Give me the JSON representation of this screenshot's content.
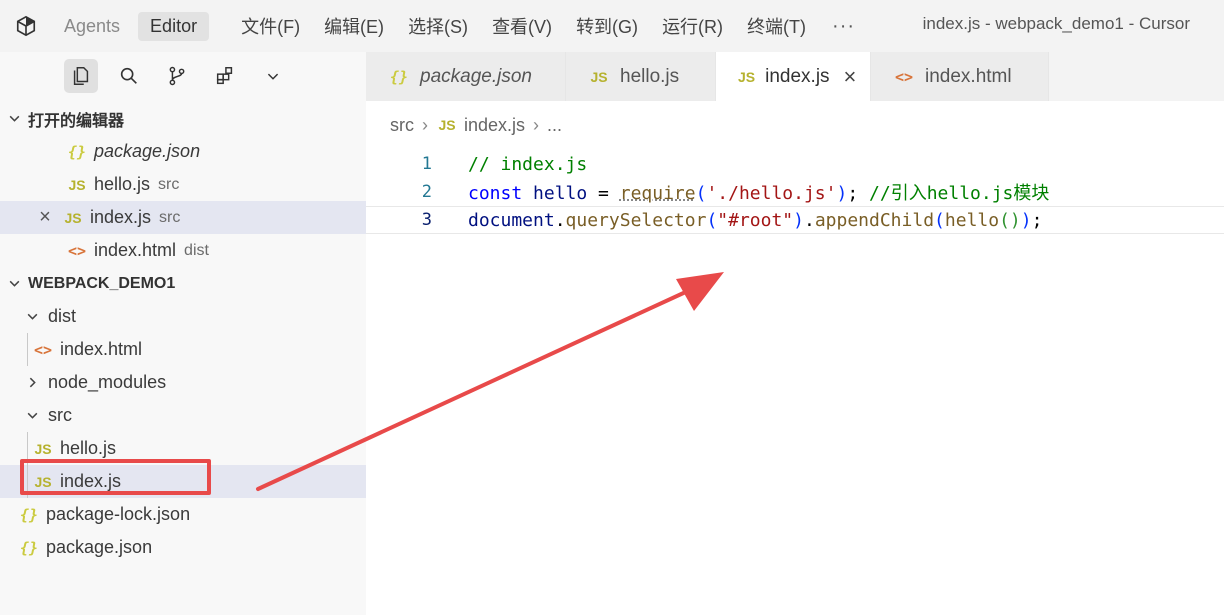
{
  "titlebar": {
    "modes": [
      "Agents",
      "Editor"
    ],
    "menu": [
      "文件(F)",
      "编辑(E)",
      "选择(S)",
      "查看(V)",
      "转到(G)",
      "运行(R)",
      "终端(T)"
    ],
    "more": "···",
    "window_title": "index.js - webpack_demo1 - Cursor"
  },
  "icons": {
    "json": "{}",
    "js": "JS",
    "html": "<>",
    "close": "×"
  },
  "sidebar": {
    "open_editors_title": "打开的编辑器",
    "open_editors": [
      {
        "name": "package.json",
        "desc": ""
      },
      {
        "name": "hello.js",
        "desc": "src"
      },
      {
        "name": "index.js",
        "desc": "src"
      },
      {
        "name": "index.html",
        "desc": "dist"
      }
    ],
    "project_title": "WEBPACK_DEMO1",
    "tree": {
      "dist": "dist",
      "dist_index_html": "index.html",
      "node_modules": "node_modules",
      "src": "src",
      "hello_js": "hello.js",
      "index_js": "index.js",
      "package_lock": "package-lock.json",
      "package_json": "package.json"
    }
  },
  "tabs": [
    {
      "label": "package.json"
    },
    {
      "label": "hello.js"
    },
    {
      "label": "index.js"
    },
    {
      "label": "index.html"
    }
  ],
  "breadcrumb": {
    "folder": "src",
    "file": "index.js",
    "ellipsis": "..."
  },
  "code": {
    "line_numbers": [
      "1",
      "2",
      "3"
    ],
    "l1": {
      "comment": "// index.js"
    },
    "l2": {
      "kw": "const",
      "var": "hello",
      "eq": " = ",
      "fn": "require",
      "open": "(",
      "str": "'./hello.js'",
      "close": ")",
      "semi": "; ",
      "comment": "//引入hello.js模块"
    },
    "l3": {
      "obj": "document",
      "dot1": ".",
      "fn1": "querySelector",
      "open1": "(",
      "str": "\"#root\"",
      "close1": ")",
      "dot2": ".",
      "fn2": "appendChild",
      "open2": "(",
      "fn3": "hello",
      "open3": "()",
      "close2": ")",
      "semi": ";"
    }
  },
  "colors": {
    "annotation": "#e84a4a",
    "selection": "#e4e6f1"
  }
}
